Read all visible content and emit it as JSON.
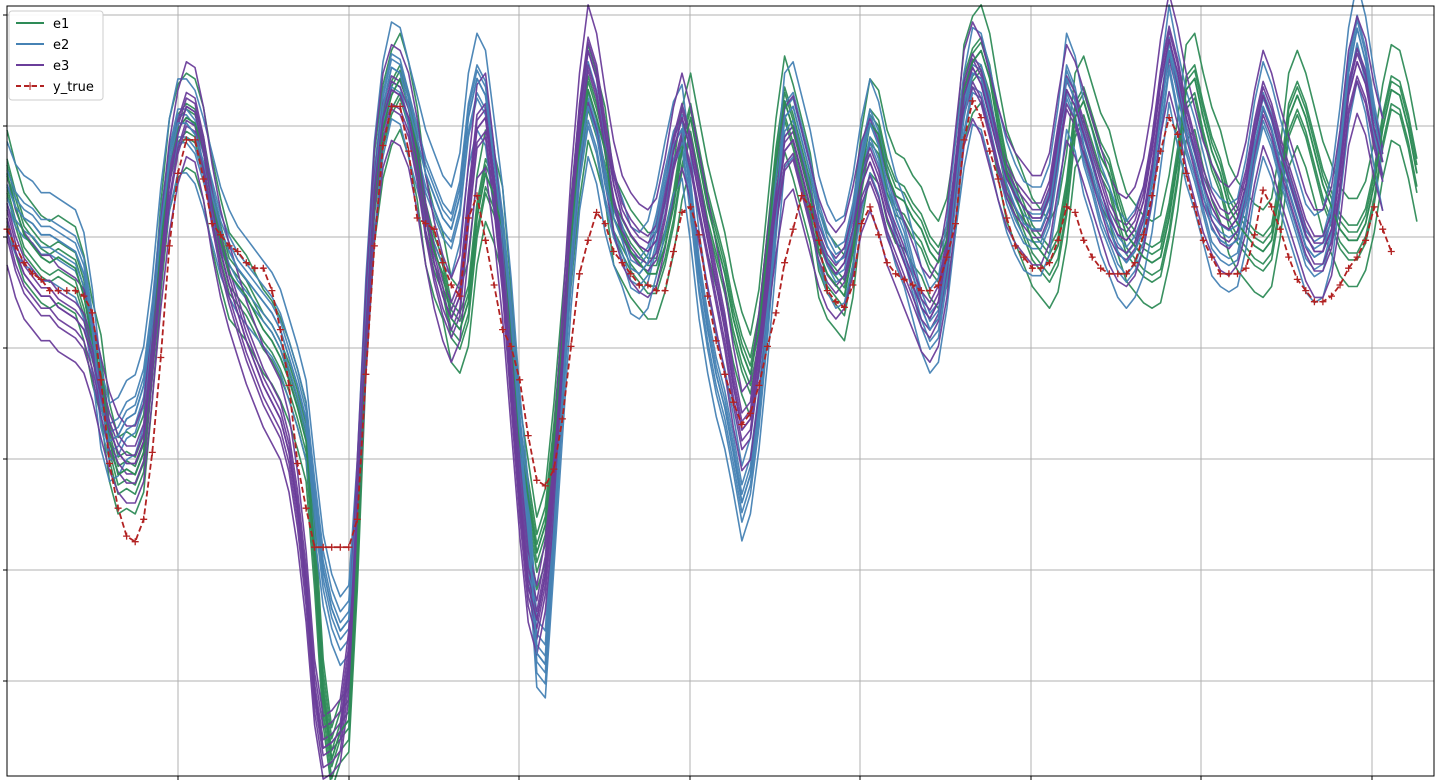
{
  "chart_data": {
    "type": "line",
    "title": "",
    "xlabel": "",
    "ylabel": "",
    "grid": true,
    "legend_placement": "top-left",
    "x_range": [
      0,
      167
    ],
    "y_range": [
      -0.2,
      1.18
    ],
    "legend": [
      "e1",
      "e2",
      "e3",
      "y_true"
    ],
    "series": [
      {
        "name": "e1",
        "color": "#2e8b57",
        "values": [
          0.88,
          0.82,
          0.77,
          0.75,
          0.73,
          0.72,
          0.73,
          0.72,
          0.71,
          0.66,
          0.58,
          0.52,
          0.4,
          0.34,
          0.35,
          0.34,
          0.38,
          0.55,
          0.75,
          0.9,
          0.96,
          0.98,
          0.97,
          0.92,
          0.83,
          0.76,
          0.7,
          0.68,
          0.66,
          0.63,
          0.6,
          0.58,
          0.55,
          0.51,
          0.46,
          0.4,
          0.2,
          -0.05,
          -0.17,
          -0.12,
          -0.1,
          0.2,
          0.6,
          0.84,
          0.96,
          1.02,
          1.05,
          1.0,
          0.92,
          0.8,
          0.74,
          0.7,
          0.62,
          0.6,
          0.65,
          0.8,
          0.88,
          0.84,
          0.78,
          0.6,
          0.4,
          0.3,
          0.2,
          0.25,
          0.4,
          0.58,
          0.76,
          0.92,
          1.03,
          0.98,
          0.92,
          0.8,
          0.77,
          0.74,
          0.72,
          0.7,
          0.7,
          0.75,
          0.82,
          0.92,
          0.98,
          0.9,
          0.82,
          0.76,
          0.7,
          0.62,
          0.56,
          0.52,
          0.6,
          0.75,
          0.9,
          1.01,
          0.96,
          0.9,
          0.84,
          0.74,
          0.7,
          0.68,
          0.66,
          0.74,
          0.88,
          0.97,
          0.95,
          0.88,
          0.84,
          0.83,
          0.8,
          0.78,
          0.74,
          0.72,
          0.76,
          0.86,
          1.03,
          1.08,
          1.1,
          1.05,
          0.96,
          0.88,
          0.84,
          0.8,
          0.76,
          0.74,
          0.72,
          0.75,
          0.84,
          0.98,
          1.01,
          0.96,
          0.91,
          0.88,
          0.82,
          0.77,
          0.75,
          0.73,
          0.72,
          0.73,
          0.8,
          0.9,
          1.03,
          1.05,
          0.98,
          0.92,
          0.88,
          0.82,
          0.79,
          0.77,
          0.75,
          0.74,
          0.76,
          0.85,
          0.98,
          1.02,
          0.98,
          0.92,
          0.86,
          0.82,
          0.78,
          0.76,
          0.76,
          0.79,
          0.86,
          0.96,
          1.03,
          1.02,
          0.96,
          0.88
        ]
      },
      {
        "name": "e2",
        "color": "#4682b4",
        "values": [
          0.86,
          0.82,
          0.8,
          0.79,
          0.77,
          0.77,
          0.76,
          0.75,
          0.74,
          0.7,
          0.6,
          0.46,
          0.4,
          0.41,
          0.44,
          0.45,
          0.5,
          0.62,
          0.78,
          0.9,
          0.97,
          0.97,
          0.95,
          0.9,
          0.84,
          0.78,
          0.74,
          0.71,
          0.69,
          0.67,
          0.65,
          0.63,
          0.6,
          0.55,
          0.5,
          0.44,
          0.3,
          0.17,
          0.1,
          0.06,
          0.08,
          0.3,
          0.62,
          0.86,
          1.0,
          1.07,
          1.06,
          1.0,
          0.94,
          0.88,
          0.84,
          0.8,
          0.78,
          0.84,
          0.98,
          1.05,
          1.02,
          0.9,
          0.78,
          0.62,
          0.42,
          0.26,
          0.02,
          0.0,
          0.24,
          0.48,
          0.72,
          0.9,
          1.0,
          0.95,
          0.86,
          0.8,
          0.76,
          0.71,
          0.7,
          0.72,
          0.78,
          0.86,
          0.93,
          0.96,
          0.84,
          0.7,
          0.6,
          0.52,
          0.46,
          0.38,
          0.29,
          0.34,
          0.46,
          0.62,
          0.8,
          0.98,
          1.0,
          0.94,
          0.88,
          0.8,
          0.75,
          0.72,
          0.73,
          0.8,
          0.9,
          0.97,
          0.93,
          0.86,
          0.8,
          0.76,
          0.7,
          0.64,
          0.6,
          0.62,
          0.72,
          0.86,
          0.98,
          1.06,
          1.05,
          0.99,
          0.92,
          0.86,
          0.82,
          0.79,
          0.78,
          0.78,
          0.82,
          0.92,
          1.05,
          1.01,
          0.93,
          0.88,
          0.82,
          0.78,
          0.74,
          0.72,
          0.74,
          0.78,
          0.86,
          0.98,
          1.1,
          1.02,
          0.95,
          0.9,
          0.84,
          0.78,
          0.76,
          0.75,
          0.76,
          0.83,
          0.93,
          1.0,
          0.96,
          0.9,
          0.85,
          0.8,
          0.75,
          0.73,
          0.74,
          0.8,
          0.92,
          1.06,
          1.14,
          1.08,
          0.98,
          0.9
        ]
      },
      {
        "name": "e3",
        "color": "#6a3d9a",
        "values": [
          0.8,
          0.74,
          0.7,
          0.68,
          0.66,
          0.66,
          0.64,
          0.63,
          0.62,
          0.6,
          0.55,
          0.48,
          0.42,
          0.38,
          0.36,
          0.36,
          0.4,
          0.55,
          0.72,
          0.86,
          0.95,
          1.0,
          0.99,
          0.92,
          0.82,
          0.74,
          0.68,
          0.63,
          0.58,
          0.54,
          0.5,
          0.47,
          0.44,
          0.38,
          0.28,
          0.14,
          -0.05,
          -0.15,
          -0.14,
          -0.12,
          0.0,
          0.3,
          0.6,
          0.85,
          0.98,
          1.03,
          1.02,
          0.98,
          0.9,
          0.8,
          0.72,
          0.66,
          0.62,
          0.66,
          0.82,
          0.96,
          0.98,
          0.85,
          0.7,
          0.5,
          0.3,
          0.14,
          0.08,
          0.16,
          0.34,
          0.56,
          0.8,
          0.98,
          1.1,
          1.05,
          0.95,
          0.86,
          0.8,
          0.77,
          0.75,
          0.74,
          0.76,
          0.83,
          0.92,
          0.98,
          0.92,
          0.84,
          0.76,
          0.68,
          0.6,
          0.5,
          0.42,
          0.44,
          0.56,
          0.7,
          0.82,
          0.92,
          0.94,
          0.88,
          0.82,
          0.76,
          0.72,
          0.7,
          0.72,
          0.78,
          0.86,
          0.9,
          0.86,
          0.8,
          0.76,
          0.72,
          0.68,
          0.64,
          0.62,
          0.65,
          0.74,
          0.88,
          1.02,
          1.07,
          1.04,
          0.98,
          0.92,
          0.87,
          0.84,
          0.82,
          0.8,
          0.8,
          0.84,
          0.94,
          1.03,
          1.0,
          0.95,
          0.9,
          0.85,
          0.8,
          0.77,
          0.76,
          0.78,
          0.83,
          0.92,
          1.04,
          1.12,
          1.06,
          0.98,
          0.92,
          0.86,
          0.82,
          0.79,
          0.78,
          0.8,
          0.86,
          0.95,
          1.02,
          0.98,
          0.92,
          0.87,
          0.82,
          0.77,
          0.74,
          0.74,
          0.78,
          0.88,
          1.02,
          1.08,
          1.04,
          0.96,
          0.9
        ]
      },
      {
        "name": "y_true",
        "color": "#b22222",
        "values": [
          0.78,
          0.75,
          0.72,
          0.7,
          0.69,
          0.67,
          0.67,
          0.67,
          0.67,
          0.66,
          0.63,
          0.51,
          0.36,
          0.28,
          0.23,
          0.22,
          0.26,
          0.38,
          0.55,
          0.75,
          0.88,
          0.94,
          0.94,
          0.87,
          0.79,
          0.77,
          0.75,
          0.74,
          0.72,
          0.71,
          0.71,
          0.67,
          0.6,
          0.5,
          0.36,
          0.28,
          0.21,
          0.21,
          0.21,
          0.21,
          0.21,
          0.26,
          0.52,
          0.75,
          0.93,
          1.0,
          1.0,
          0.92,
          0.8,
          0.79,
          0.78,
          0.72,
          0.68,
          0.66,
          0.8,
          0.84,
          0.76,
          0.68,
          0.6,
          0.57,
          0.51,
          0.41,
          0.33,
          0.32,
          0.35,
          0.44,
          0.57,
          0.7,
          0.76,
          0.81,
          0.79,
          0.74,
          0.72,
          0.7,
          0.68,
          0.68,
          0.67,
          0.67,
          0.74,
          0.81,
          0.82,
          0.77,
          0.66,
          0.58,
          0.52,
          0.47,
          0.43,
          0.45,
          0.5,
          0.57,
          0.63,
          0.72,
          0.78,
          0.84,
          0.82,
          0.76,
          0.67,
          0.65,
          0.64,
          0.68,
          0.79,
          0.82,
          0.77,
          0.72,
          0.7,
          0.69,
          0.68,
          0.67,
          0.67,
          0.68,
          0.73,
          0.79,
          0.94,
          1.01,
          0.98,
          0.92,
          0.87,
          0.8,
          0.75,
          0.73,
          0.71,
          0.71,
          0.72,
          0.76,
          0.82,
          0.81,
          0.76,
          0.73,
          0.71,
          0.7,
          0.7,
          0.7,
          0.72,
          0.77,
          0.84,
          0.92,
          0.98,
          0.95,
          0.88,
          0.82,
          0.76,
          0.73,
          0.7,
          0.7,
          0.7,
          0.71,
          0.77,
          0.85,
          0.82,
          0.78,
          0.73,
          0.69,
          0.67,
          0.65,
          0.65,
          0.66,
          0.68,
          0.71,
          0.73,
          0.76,
          0.82,
          0.78,
          0.74
        ]
      }
    ]
  }
}
